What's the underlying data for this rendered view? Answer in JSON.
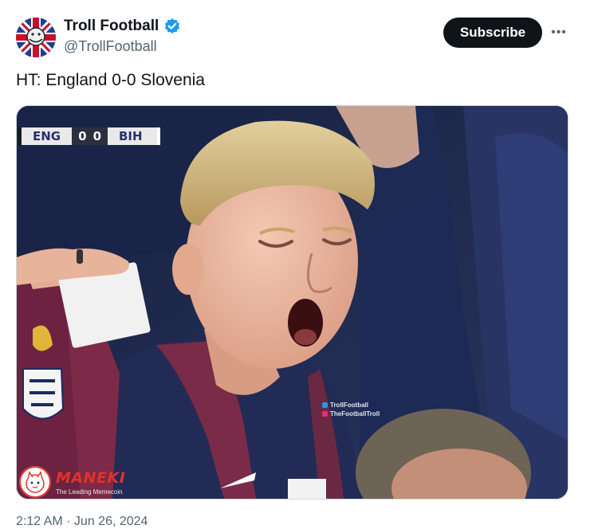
{
  "post": {
    "author": {
      "display_name": "Troll Football",
      "handle": "@TrollFootball",
      "avatar": "troll-football-avatar",
      "verified": true,
      "verified_icon": "verified-badge-icon"
    },
    "subscribe_label": "Subscribe",
    "more_icon": "more-options-icon",
    "more_glyph": "•••",
    "text": "HT: England 0-0 Slovenia",
    "timestamp": "2:12 AM · Jun 26, 2024"
  },
  "media": {
    "scorebug": {
      "home": "ENG",
      "home_score": "0",
      "away_score": "0",
      "away": "BIH"
    },
    "watermark": {
      "twitter": "TrollFootball",
      "instagram": "TheFootballTroll"
    },
    "sponsor": {
      "name": "MANEKI",
      "tagline": "The Leading Memecoin"
    }
  },
  "colors": {
    "accent": "#0f1419",
    "verified": "#1d9bf0",
    "secondary_text": "#536471",
    "brand_red": "#e0322c"
  }
}
